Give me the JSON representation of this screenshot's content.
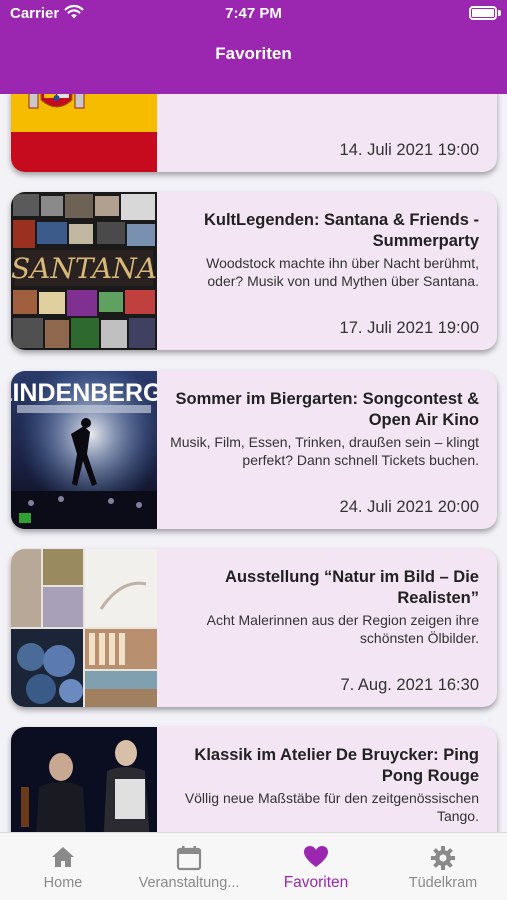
{
  "status_bar": {
    "carrier": "Carrier",
    "time": "7:47 PM"
  },
  "header": {
    "title": "Favoriten"
  },
  "events": [
    {
      "title": "",
      "description": "",
      "date": "14. Juli 2021 19:00",
      "image": "spain-flag"
    },
    {
      "title": "KultLegenden: Santana & Friends - Summerparty",
      "description": "Woodstock machte ihn über Nacht berühmt, oder? Musik von und Mythen über Santana.",
      "date": "17. Juli 2021 19:00",
      "image": "santana-collage"
    },
    {
      "title": "Sommer im Biergarten: Songcontest & Open Air Kino",
      "description": "Musik, Film, Essen, Trinken, draußen sein – klingt perfekt? Dann schnell Tickets buchen.",
      "date": "24. Juli 2021 20:00",
      "image": "lindenberg-poster",
      "poster_text": "LINDENBERG!"
    },
    {
      "title": "Ausstellung “Natur im Bild – Die Realisten”",
      "description": "Acht Malerinnen aus der Region zeigen ihre schönsten Ölbilder.",
      "date": "7. Aug. 2021 16:30",
      "image": "paintings-collage"
    },
    {
      "title": "Klassik im Atelier De Bruycker: Ping Pong Rouge",
      "description": "Völlig neue Maßstäbe für den zeitgenössischen Tango.",
      "date": "",
      "image": "musicians-photo"
    }
  ],
  "tabbar": {
    "home": "Home",
    "events": "Veranstaltung...",
    "favorites": "Favoriten",
    "misc": "Tüdelkram"
  },
  "colors": {
    "brand": "#9b27b0",
    "card": "#f3e5f4",
    "inactive": "#8a8a8a"
  }
}
